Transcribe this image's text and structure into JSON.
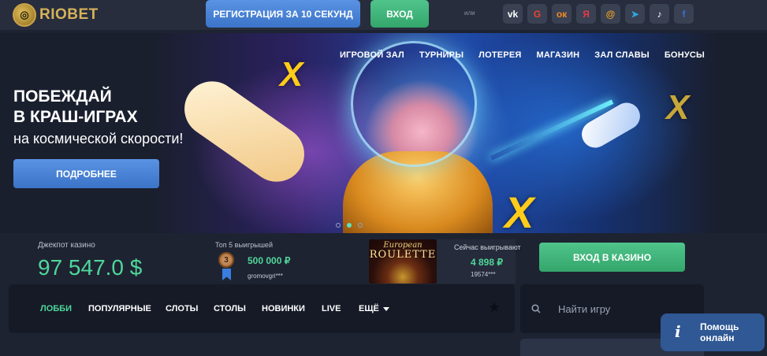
{
  "header": {
    "logo_text": "RIOBET",
    "register_label": "РЕГИСТРАЦИЯ ЗА 10 СЕКУНД",
    "login_label": "ВХОД",
    "or_text": "или",
    "socials": [
      {
        "icon": "vk-icon",
        "label": "vk",
        "color": "#3a4152"
      },
      {
        "icon": "google-icon",
        "label": "G",
        "color": "#3a4152"
      },
      {
        "icon": "odnoklassniki-icon",
        "label": "ок",
        "color": "#f08a24"
      },
      {
        "icon": "yandex-icon",
        "label": "Я",
        "color": "#e8394a"
      },
      {
        "icon": "mailru-icon",
        "label": "@",
        "color": "#f5a623"
      },
      {
        "icon": "telegram-icon",
        "label": "➤",
        "color": "#2ca5e0"
      },
      {
        "icon": "tiktok-icon",
        "label": "♪",
        "color": "#ffffff"
      },
      {
        "icon": "facebook-icon",
        "label": "f",
        "color": "#3b6fd6"
      }
    ]
  },
  "banner": {
    "nav": [
      "ИГРОВОЙ ЗАЛ",
      "ТУРНИРЫ",
      "ЛОТЕРЕЯ",
      "МАГАЗИН",
      "ЗАЛ СЛАВЫ",
      "БОНУСЫ"
    ],
    "title_line1": "ПОБЕЖДАЙ",
    "title_line2": "В КРАШ-ИГРАХ",
    "subtitle": "на космической скорости!",
    "more_label": "ПОДРОБНЕЕ",
    "slide_count": 3,
    "active_slide": 2,
    "x_text": "X"
  },
  "stats": {
    "jackpot_label": "Джекпот казино",
    "jackpot_value": "97 547.0 $",
    "top5_label": "Топ 5 выигрышей",
    "top5_rank": "3",
    "top5_amount": "500 000 ₽",
    "top5_user": "gromovgri***",
    "game_title_top": "European",
    "game_title_main": "ROULETTE",
    "now_label": "Сейчас выигрывают",
    "now_amount": "4 898 ₽",
    "now_user": "19574***",
    "casino_button": "ВХОД В КАЗИНО"
  },
  "tabs": {
    "items": [
      "ЛОББИ",
      "ПОПУЛЯРНЫЕ",
      "СЛОТЫ",
      "СТОЛЫ",
      "НОВИНКИ",
      "LIVE",
      "ЕЩЁ"
    ],
    "active": "ЛОББИ"
  },
  "search": {
    "placeholder": "Найти игру"
  },
  "help": {
    "icon_text": "i",
    "line1": "Помощь",
    "line2": "онлайн"
  },
  "colors": {
    "accent_green": "#4fd79a",
    "button_blue": "#4a84d6",
    "button_green": "#3db57a",
    "background": "#1e2332"
  }
}
